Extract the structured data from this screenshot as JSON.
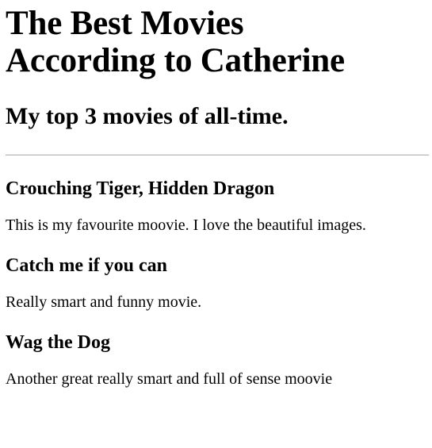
{
  "page": {
    "title_line1": "The Best Movies",
    "title_line2": "According to Catherine",
    "subtitle": "My top 3 movies of all-time."
  },
  "movies": [
    {
      "title": "Crouching Tiger, Hidden Dragon",
      "description": "This is my favourite moovie. I love the beautiful images."
    },
    {
      "title": "Catch me if you can",
      "description": "Really smart and funny movie."
    },
    {
      "title": "Wag the Dog",
      "description": "Another great really smart and full of sense moovie"
    }
  ]
}
